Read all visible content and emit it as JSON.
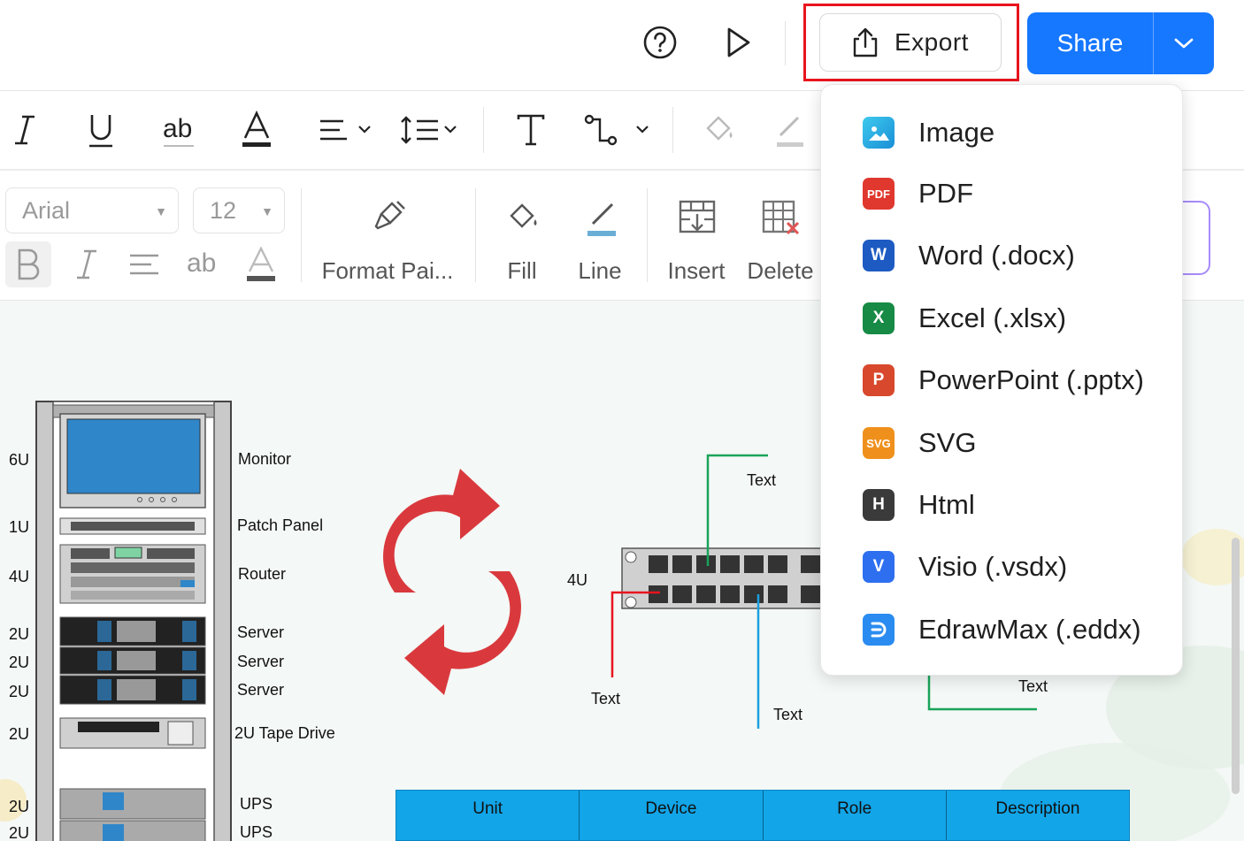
{
  "topbar": {
    "help_icon": "help-circle-icon",
    "play_icon": "play-icon",
    "export_label": "Export",
    "export_icon": "share-upload-icon",
    "share_label": "Share"
  },
  "toolbar1": {
    "icons": [
      "italic-icon",
      "underline-icon",
      "strikethrough-ab-icon",
      "font-color-icon",
      "align-icon",
      "line-spacing-icon",
      "text-icon",
      "connector-icon",
      "fill-icon",
      "line-icon"
    ]
  },
  "toolbar2": {
    "font_family": "Arial",
    "font_size": "12",
    "format_painter": "Format Pai...",
    "fill": "Fill",
    "line": "Line",
    "insert": "Insert",
    "delete": "Delete"
  },
  "export_menu": {
    "items": [
      {
        "label": "Image",
        "icon": "image-icon",
        "color": "#1aa7e6",
        "glyph": "▲"
      },
      {
        "label": "PDF",
        "icon": "pdf-icon",
        "color": "#e0382e",
        "glyph": "PDF"
      },
      {
        "label": "Word (.docx)",
        "icon": "word-icon",
        "color": "#1d5bc2",
        "glyph": "W"
      },
      {
        "label": "Excel (.xlsx)",
        "icon": "excel-icon",
        "color": "#178a45",
        "glyph": "X"
      },
      {
        "label": "PowerPoint (.pptx)",
        "icon": "powerpoint-icon",
        "color": "#d8482c",
        "glyph": "P"
      },
      {
        "label": "SVG",
        "icon": "svg-icon",
        "color": "#f0901c",
        "glyph": "SVG"
      },
      {
        "label": "Html",
        "icon": "html-icon",
        "color": "#3a3a3a",
        "glyph": "H"
      },
      {
        "label": "Visio (.vsdx)",
        "icon": "visio-icon",
        "color": "#2e6ff0",
        "glyph": "V"
      },
      {
        "label": "EdrawMax (.eddx)",
        "icon": "edrawmax-icon",
        "color": "#2a8cf0",
        "glyph": "D"
      }
    ]
  },
  "diagram": {
    "units": [
      "6U",
      "1U",
      "4U",
      "2U",
      "2U",
      "2U",
      "2U",
      "2U",
      "2U"
    ],
    "devices": [
      "Monitor",
      "Patch Panel",
      "Router",
      "Server",
      "Server",
      "Server",
      "2U Tape Drive",
      "UPS",
      "UPS"
    ],
    "switch_unit": "4U",
    "callouts": [
      "Text",
      "Text",
      "Text",
      "Text"
    ],
    "table_headers": [
      "Unit",
      "Device",
      "Role",
      "Description"
    ]
  }
}
